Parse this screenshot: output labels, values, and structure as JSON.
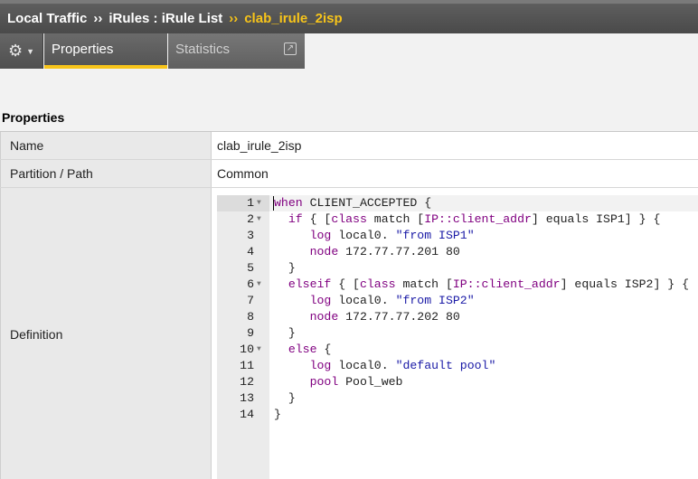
{
  "breadcrumb": {
    "section": "Local Traffic",
    "sep": "››",
    "list": "iRules : iRule List",
    "current": "clab_irule_2isp"
  },
  "tabs": {
    "properties": "Properties",
    "statistics": "Statistics",
    "gear_icon": "gear-icon",
    "caret_icon": "caret-down-icon",
    "popout_icon": "popout-icon"
  },
  "section_title": "Properties",
  "properties": {
    "name_label": "Name",
    "name_value": "clab_irule_2isp",
    "partition_label": "Partition / Path",
    "partition_value": "Common",
    "definition_label": "Definition"
  },
  "colors": {
    "accent": "#f7c41a",
    "keyword": "#800080",
    "string": "#1a1aa6"
  },
  "code": [
    {
      "n": "1",
      "fold": true,
      "parts": [
        {
          "t": "when",
          "c": "kw"
        },
        {
          "t": " CLIENT_ACCEPTED {",
          "c": ""
        }
      ]
    },
    {
      "n": "2",
      "fold": true,
      "parts": [
        {
          "t": "  ",
          "c": ""
        },
        {
          "t": "if",
          "c": "kw"
        },
        {
          "t": " { [",
          "c": ""
        },
        {
          "t": "class",
          "c": "kw"
        },
        {
          "t": " match [",
          "c": ""
        },
        {
          "t": "IP::client_addr",
          "c": "kw"
        },
        {
          "t": "] equals ISP1] } {",
          "c": ""
        }
      ]
    },
    {
      "n": "3",
      "fold": false,
      "parts": [
        {
          "t": "     ",
          "c": ""
        },
        {
          "t": "log",
          "c": "kw"
        },
        {
          "t": " local0. ",
          "c": ""
        },
        {
          "t": "\"from ISP1\"",
          "c": "str"
        }
      ]
    },
    {
      "n": "4",
      "fold": false,
      "parts": [
        {
          "t": "     ",
          "c": ""
        },
        {
          "t": "node",
          "c": "kw"
        },
        {
          "t": " 172.77.77.201 80",
          "c": ""
        }
      ]
    },
    {
      "n": "5",
      "fold": false,
      "parts": [
        {
          "t": "  }",
          "c": ""
        }
      ]
    },
    {
      "n": "6",
      "fold": true,
      "parts": [
        {
          "t": "  ",
          "c": ""
        },
        {
          "t": "elseif",
          "c": "kw"
        },
        {
          "t": " { [",
          "c": ""
        },
        {
          "t": "class",
          "c": "kw"
        },
        {
          "t": " match [",
          "c": ""
        },
        {
          "t": "IP::client_addr",
          "c": "kw"
        },
        {
          "t": "] equals ISP2] } {",
          "c": ""
        }
      ]
    },
    {
      "n": "7",
      "fold": false,
      "parts": [
        {
          "t": "     ",
          "c": ""
        },
        {
          "t": "log",
          "c": "kw"
        },
        {
          "t": " local0. ",
          "c": ""
        },
        {
          "t": "\"from ISP2\"",
          "c": "str"
        }
      ]
    },
    {
      "n": "8",
      "fold": false,
      "parts": [
        {
          "t": "     ",
          "c": ""
        },
        {
          "t": "node",
          "c": "kw"
        },
        {
          "t": " 172.77.77.202 80",
          "c": ""
        }
      ]
    },
    {
      "n": "9",
      "fold": false,
      "parts": [
        {
          "t": "  }",
          "c": ""
        }
      ]
    },
    {
      "n": "10",
      "fold": true,
      "parts": [
        {
          "t": "  ",
          "c": ""
        },
        {
          "t": "else",
          "c": "kw"
        },
        {
          "t": " {",
          "c": ""
        }
      ]
    },
    {
      "n": "11",
      "fold": false,
      "parts": [
        {
          "t": "     ",
          "c": ""
        },
        {
          "t": "log",
          "c": "kw"
        },
        {
          "t": " local0. ",
          "c": ""
        },
        {
          "t": "\"default pool\"",
          "c": "str"
        }
      ]
    },
    {
      "n": "12",
      "fold": false,
      "parts": [
        {
          "t": "     ",
          "c": ""
        },
        {
          "t": "pool",
          "c": "kw"
        },
        {
          "t": " Pool_web",
          "c": ""
        }
      ]
    },
    {
      "n": "13",
      "fold": false,
      "parts": [
        {
          "t": "  }",
          "c": ""
        }
      ]
    },
    {
      "n": "14",
      "fold": false,
      "parts": [
        {
          "t": "}",
          "c": ""
        }
      ]
    }
  ]
}
